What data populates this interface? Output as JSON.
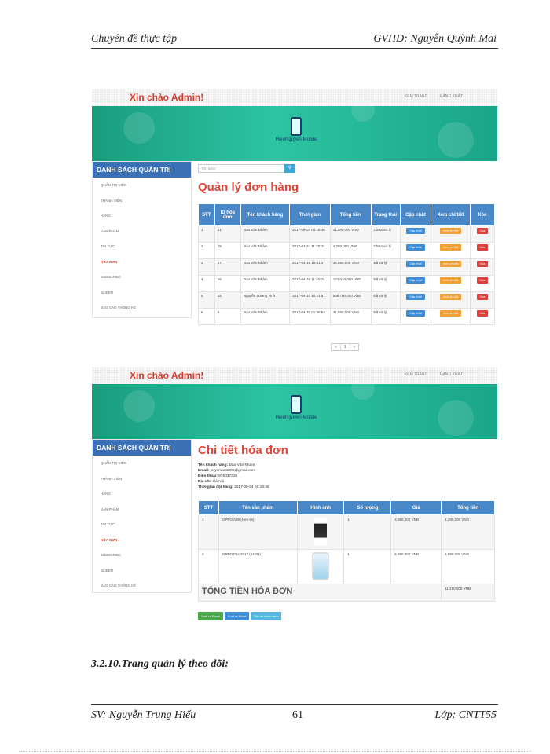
{
  "header": {
    "left": "Chuyên đề thực tập",
    "right": "GVHD:  Nguyễn Quỳnh Mai"
  },
  "footer": {
    "left": "SV: Nguyễn Trung Hiếu",
    "page": "61",
    "right": "Lớp: CNTT55"
  },
  "section_heading": "3.2.10.Trang quản lý theo dõi:",
  "site": {
    "greeting": "Xin chào Admin!",
    "nav": [
      "XEM TRANG",
      "ĐĂNG XUẤT"
    ],
    "logo_text": "HieuNguyen-Mobile",
    "sidebar_title": "DANH SÁCH QUẢN TRỊ",
    "sidebar_items": [
      "QUẢN TRỊ VIÊN",
      "THÀNH VIÊN",
      "HÃNG",
      "SẢN PHẨM",
      "TIN TỨC",
      "HÓA ĐƠN",
      "SUBSCRIBE",
      "SLIDER",
      "BÁO CÁO THỐNG KÊ"
    ],
    "sidebar_active": "HÓA ĐƠN"
  },
  "orders_page": {
    "search_placeholder": "Tìm kiếm",
    "title": "Quản lý đơn hàng",
    "columns": [
      "STT",
      "ID hóa đơn",
      "Tên khách hàng",
      "Thời gian",
      "Tổng tiền",
      "Trạng thái",
      "Cập nhật",
      "Xem chi tiết",
      "Xóa"
    ],
    "rows": [
      {
        "stt": "1",
        "id": "21",
        "customer": "Đào Văn Nhâm",
        "time": "2017-05-04 00:19:46",
        "total": "11,280,000 VNĐ",
        "status": "Chưa xử lý"
      },
      {
        "stt": "2",
        "id": "18",
        "customer": "Đào Văn Nhâm",
        "time": "2017-04-24 11:28:33",
        "total": "4,290,000 VNĐ",
        "status": "Chưa xử lý"
      },
      {
        "stt": "3",
        "id": "17",
        "customer": "Đào Văn Nhâm",
        "time": "2017-04-16 19:01:47",
        "total": "46,860,000 VNĐ",
        "status": "Đã xử lý"
      },
      {
        "stt": "4",
        "id": "16",
        "customer": "Đào Văn Nhâm",
        "time": "2017-04-16 11:40:32",
        "total": "124,610,000 VNĐ",
        "status": "Đã xử lý"
      },
      {
        "stt": "5",
        "id": "15",
        "customer": "Nguyễn Lương Vinh",
        "time": "2017-04-15 10:51:51",
        "total": "568,700,000 VNĐ",
        "status": "Đã xử lý"
      },
      {
        "stt": "6",
        "id": "8",
        "customer": "Đào Văn Nhâm",
        "time": "2017-04-15 01:36:54",
        "total": "41,550,000 VNĐ",
        "status": "Đã xử lý"
      }
    ],
    "btn_update": "Cập nhật",
    "btn_view": "Xem chi tiết",
    "btn_delete": "Xóa",
    "pager": [
      "«",
      "1",
      "»"
    ]
  },
  "detail_page": {
    "title": "Chi tiết hóa đơn",
    "info": [
      {
        "label": "Tên khách hàng:",
        "value": "Đào Văn Nhâm"
      },
      {
        "label": "Email:",
        "value": "puyomart1009@gmail.com"
      },
      {
        "label": "Điện thoại:",
        "value": "976037325"
      },
      {
        "label": "Địa chỉ:",
        "value": "Hà Nội"
      },
      {
        "label": "Thời gian đặt hàng:",
        "value": "2017-05-04 00:19:46"
      }
    ],
    "columns": [
      "STT",
      "Tên sản phẩm",
      "Hình ảnh",
      "Số lượng",
      "Giá",
      "Tổng tiền"
    ],
    "rows": [
      {
        "stt": "1",
        "name": "OPPO A39 (Neo 9s)",
        "qty": "1",
        "price": "4,990,000 VNĐ",
        "total": "4,290,000 VNĐ"
      },
      {
        "stt": "2",
        "name": "OPPO F1s 2017 (64GB)",
        "qty": "1",
        "price": "6,990,000 VNĐ",
        "total": "6,990,000 VNĐ"
      }
    ],
    "grand_total_label": "TỔNG TIỀN HÓA ĐƠN",
    "grand_total": "11,280,000 VNĐ",
    "actions": [
      "Xuất ra Excel",
      "Xuất ra Word",
      "Trở về danh sách"
    ]
  }
}
